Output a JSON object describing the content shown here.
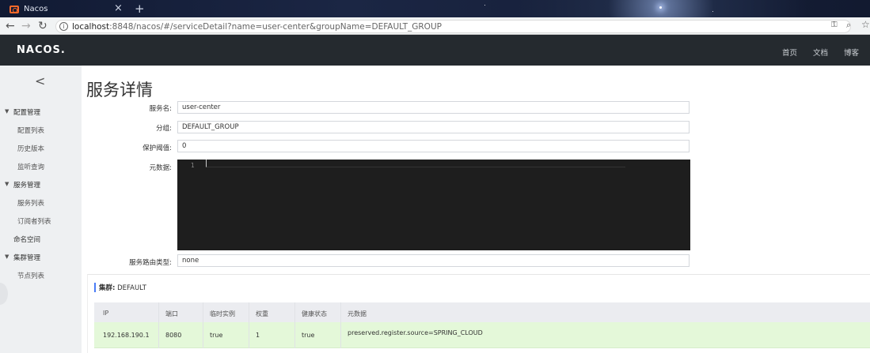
{
  "browser": {
    "tab_title": "Nacos",
    "tab_close": "×",
    "tab_new": "+",
    "url_host": "localhost",
    "url_rest": ":8848/nacos/#/serviceDetail?name=user-center&groupName=DEFAULT_GROUP",
    "icons": [
      "back-arrow-icon",
      "forward-arrow-icon",
      "reload-icon",
      "info-icon",
      "key-icon",
      "zoom-icon",
      "bookmark-star-icon"
    ]
  },
  "header": {
    "logo": "NACOS.",
    "links": [
      "首页",
      "文档",
      "博客"
    ]
  },
  "sidebar": {
    "groups": [
      {
        "label": "配置管理",
        "items": [
          "配置列表",
          "历史版本",
          "监听查询"
        ]
      },
      {
        "label": "服务管理",
        "items": [
          "服务列表",
          "订阅者列表"
        ]
      },
      {
        "label": "命名空间",
        "items": []
      },
      {
        "label": "集群管理",
        "items": [
          "节点列表"
        ]
      }
    ]
  },
  "page": {
    "title": "服务详情",
    "form": {
      "service_name_label": "服务名:",
      "service_name": "user-center",
      "group_label": "分组:",
      "group": "DEFAULT_GROUP",
      "threshold_label": "保护阈值:",
      "threshold": "0",
      "metadata_label": "元数据:",
      "editor_line": "1",
      "selector_label": "服务路由类型:",
      "selector": "none"
    },
    "cluster": {
      "label": "集群:",
      "name": "DEFAULT",
      "columns": [
        "IP",
        "端口",
        "临时实例",
        "权重",
        "健康状态",
        "元数据"
      ],
      "rows": [
        [
          "192.168.190.1",
          "8080",
          "true",
          "1",
          "true",
          "preserved.register.source=SPRING_CLOUD"
        ]
      ]
    }
  }
}
